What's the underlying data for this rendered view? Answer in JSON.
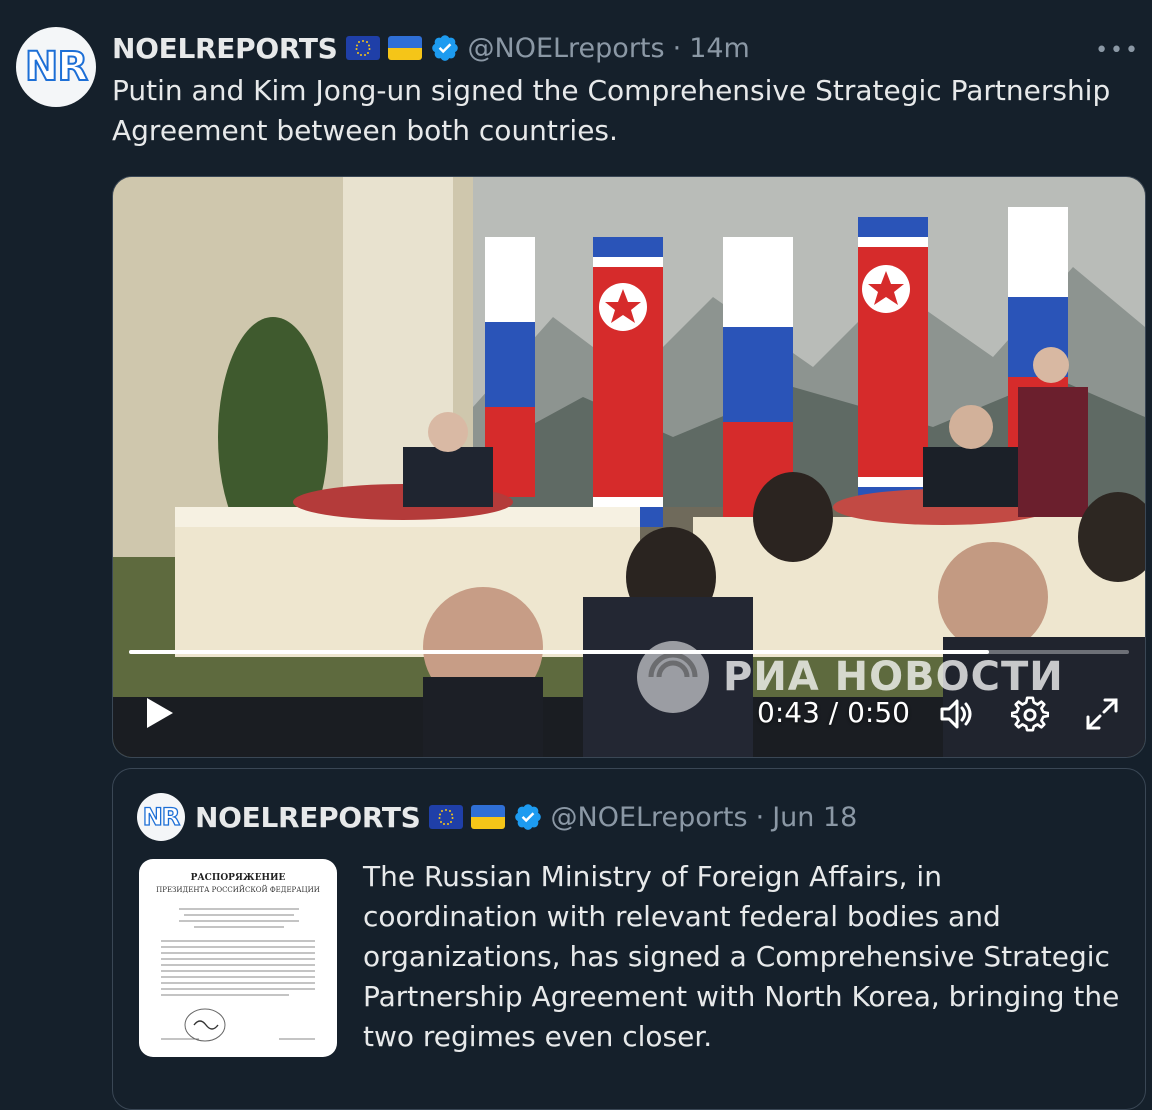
{
  "tweet": {
    "author_name": "NOELREPORTS",
    "avatar_text": "NR",
    "handle": "@NOELreports",
    "separator": "·",
    "time": "14m",
    "text": "Putin and Kim Jong-un signed the Comprehensive Strategic Partnership Agreement between both countries.",
    "more_icon": "•••"
  },
  "video": {
    "current_time": "0:43",
    "duration": "0:50",
    "time_display": "0:43 / 0:50",
    "progress": 0.86,
    "watermark": "РИА НОВОСТИ",
    "icons": [
      "play-icon",
      "volume-icon",
      "settings-icon",
      "fullscreen-icon"
    ]
  },
  "quoted": {
    "author_name": "NOELREPORTS",
    "avatar_text": "NR",
    "handle": "@NOELreports",
    "separator": "·",
    "date": "Jun 18",
    "text": "The Russian Ministry of Foreign Affairs, in coordination with relevant federal bodies and organizations, has signed a Comprehensive Strategic Partnership Agreement with North Korea, bringing the two regimes even closer.",
    "thumbnail": {
      "title": "РАСПОРЯЖЕНИЕ",
      "subtitle": "ПРЕЗИДЕНТА РОССИЙСКОЙ ФЕДЕРАЦИИ"
    }
  },
  "colors": {
    "background": "#15202b",
    "verified": "#1d9bf0",
    "muted": "#8b98a5"
  }
}
